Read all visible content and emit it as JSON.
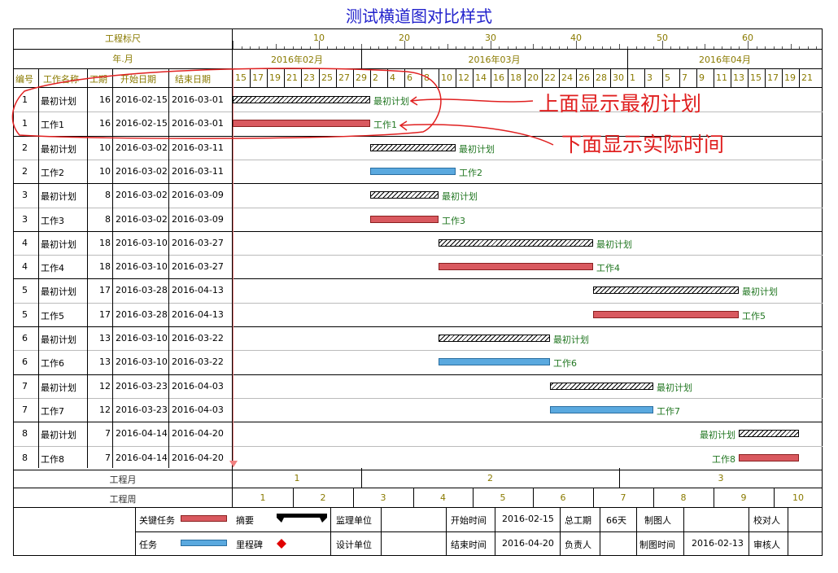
{
  "title": "测试横道图对比样式",
  "header": {
    "scale_label": "工程标尺",
    "yearmonth_label": "年.月",
    "scale_ticks": [
      "10",
      "20",
      "30",
      "40",
      "50",
      "60"
    ],
    "months": [
      "2016年02月",
      "2016年03月",
      "2016年04月"
    ],
    "days": [
      "15",
      "17",
      "19",
      "21",
      "23",
      "25",
      "27",
      "29",
      "2",
      "4",
      "6",
      "8",
      "10",
      "12",
      "14",
      "16",
      "18",
      "20",
      "22",
      "24",
      "26",
      "28",
      "30",
      "1",
      "3",
      "5",
      "7",
      "9",
      "11",
      "13",
      "15",
      "17",
      "19",
      "21"
    ],
    "columns": {
      "id": "编号",
      "name": "工作名称",
      "duration": "工期",
      "start": "开始日期",
      "end": "结束日期"
    }
  },
  "rows": [
    {
      "id": "1",
      "name": "最初计划",
      "duration": "16",
      "start": "2016-02-15",
      "end": "2016-03-01",
      "kind": "plan",
      "label": "最初计划"
    },
    {
      "id": "1",
      "name": "工作1",
      "duration": "16",
      "start": "2016-02-15",
      "end": "2016-03-01",
      "kind": "crit",
      "label": "工作1"
    },
    {
      "id": "2",
      "name": "最初计划",
      "duration": "10",
      "start": "2016-03-02",
      "end": "2016-03-11",
      "kind": "plan",
      "label": "最初计划"
    },
    {
      "id": "2",
      "name": "工作2",
      "duration": "10",
      "start": "2016-03-02",
      "end": "2016-03-11",
      "kind": "task",
      "label": "工作2"
    },
    {
      "id": "3",
      "name": "最初计划",
      "duration": "8",
      "start": "2016-03-02",
      "end": "2016-03-09",
      "kind": "plan",
      "label": "最初计划"
    },
    {
      "id": "3",
      "name": "工作3",
      "duration": "8",
      "start": "2016-03-02",
      "end": "2016-03-09",
      "kind": "crit",
      "label": "工作3"
    },
    {
      "id": "4",
      "name": "最初计划",
      "duration": "18",
      "start": "2016-03-10",
      "end": "2016-03-27",
      "kind": "plan",
      "label": "最初计划"
    },
    {
      "id": "4",
      "name": "工作4",
      "duration": "18",
      "start": "2016-03-10",
      "end": "2016-03-27",
      "kind": "crit",
      "label": "工作4"
    },
    {
      "id": "5",
      "name": "最初计划",
      "duration": "17",
      "start": "2016-03-28",
      "end": "2016-04-13",
      "kind": "plan",
      "label": "最初计划"
    },
    {
      "id": "5",
      "name": "工作5",
      "duration": "17",
      "start": "2016-03-28",
      "end": "2016-04-13",
      "kind": "crit",
      "label": "工作5"
    },
    {
      "id": "6",
      "name": "最初计划",
      "duration": "13",
      "start": "2016-03-10",
      "end": "2016-03-22",
      "kind": "plan",
      "label": "最初计划"
    },
    {
      "id": "6",
      "name": "工作6",
      "duration": "13",
      "start": "2016-03-10",
      "end": "2016-03-22",
      "kind": "task",
      "label": "工作6"
    },
    {
      "id": "7",
      "name": "最初计划",
      "duration": "12",
      "start": "2016-03-23",
      "end": "2016-04-03",
      "kind": "plan",
      "label": "最初计划"
    },
    {
      "id": "7",
      "name": "工作7",
      "duration": "12",
      "start": "2016-03-23",
      "end": "2016-04-03",
      "kind": "task",
      "label": "工作7"
    },
    {
      "id": "8",
      "name": "最初计划",
      "duration": "7",
      "start": "2016-04-14",
      "end": "2016-04-20",
      "kind": "plan",
      "label": "最初计划"
    },
    {
      "id": "8",
      "name": "工作8",
      "duration": "7",
      "start": "2016-04-14",
      "end": "2016-04-20",
      "kind": "crit",
      "label": "工作8"
    }
  ],
  "footer": {
    "month_label": "工程月",
    "months": [
      "1",
      "2",
      "3"
    ],
    "week_label": "工程周",
    "weeks": [
      "1",
      "2",
      "3",
      "4",
      "5",
      "6",
      "7",
      "8",
      "9",
      "10"
    ]
  },
  "legend": {
    "critical": "关键任务",
    "summary": "摘要",
    "task": "任务",
    "milestone": "里程碑",
    "supervisor": "监理单位",
    "designer": "设计单位",
    "start_label": "开始时间",
    "start_value": "2016-02-15",
    "end_label": "结束时间",
    "end_value": "2016-04-20",
    "total_label": "总工期",
    "total_value": "66天",
    "owner_label": "负责人",
    "drafter_label": "制图人",
    "draw_time_label": "制图时间",
    "draw_time_value": "2016-02-13",
    "proof_label": "校对人",
    "reviewer_label": "审核人"
  },
  "annotations": {
    "top": "上面显示最初计划",
    "bottom": "下面显示实际时间"
  },
  "colors": {
    "title": "#2222cc",
    "header_text": "#8a7a00",
    "critical": "#d9595f",
    "task": "#5aa9df",
    "bar_label": "#227722",
    "annotation": "#e02020",
    "milestone": "#e00000"
  }
}
